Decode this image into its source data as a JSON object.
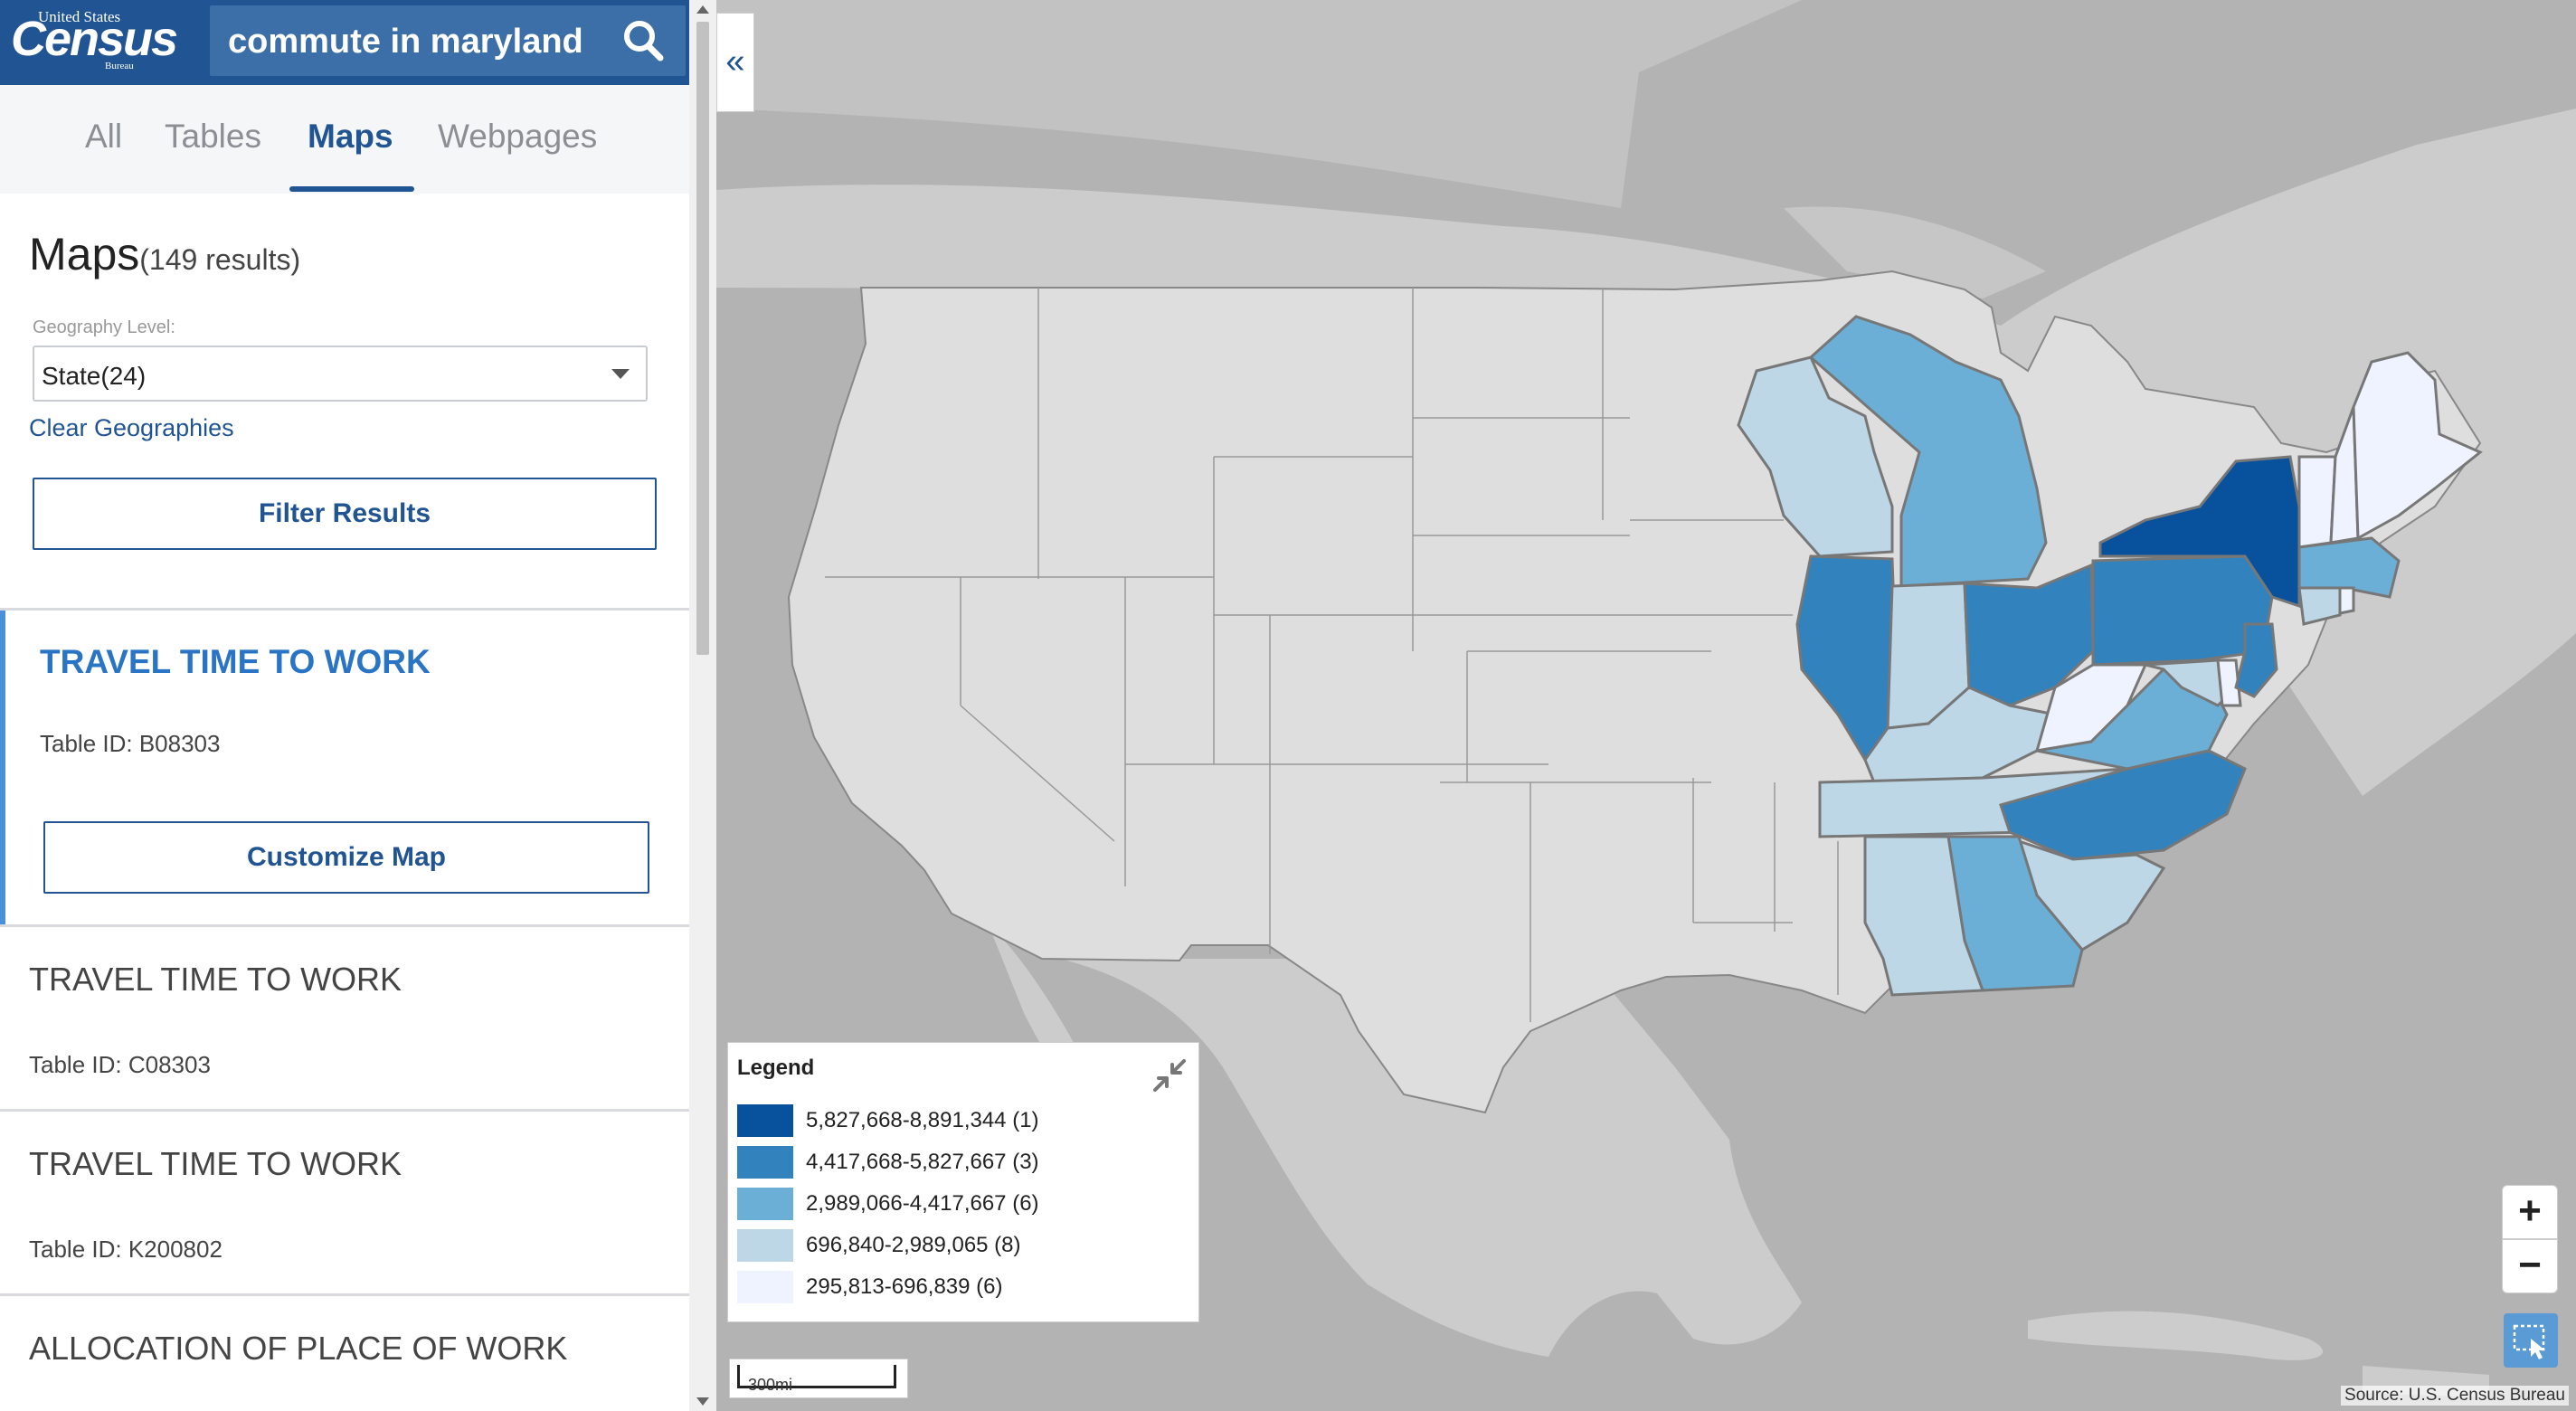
{
  "header": {
    "logo": {
      "line1": "United States",
      "word": "Census",
      "line3": "Bureau"
    },
    "search": {
      "value": "commute in maryland",
      "placeholder": ""
    }
  },
  "tabs": [
    {
      "label": "All",
      "active": false
    },
    {
      "label": "Tables",
      "active": false
    },
    {
      "label": "Maps",
      "active": true
    },
    {
      "label": "Webpages",
      "active": false
    }
  ],
  "results": {
    "heading": "Maps",
    "count": "(149 results)",
    "geography_label": "Geography Level:",
    "geography_value": "State(24)",
    "clear_label": "Clear Geographies",
    "filter_label": "Filter Results"
  },
  "cards": [
    {
      "title": "TRAVEL TIME TO WORK",
      "table_id": "Table ID: B08303",
      "button": "Customize Map",
      "selected": true
    },
    {
      "title": "TRAVEL TIME TO WORK",
      "table_id": "Table ID: C08303"
    },
    {
      "title": "TRAVEL TIME TO WORK",
      "table_id": "Table ID: K200802"
    },
    {
      "title": "ALLOCATION OF PLACE OF WORK"
    }
  ],
  "map": {
    "collapse_icon": "«",
    "legend": {
      "title": "Legend",
      "items": [
        {
          "label": "5,827,668-8,891,344 (1)",
          "color": "#08519c"
        },
        {
          "label": "4,417,668-5,827,667 (3)",
          "color": "#3182bd"
        },
        {
          "label": "2,989,066-4,417,667 (6)",
          "color": "#6baed6"
        },
        {
          "label": "696,840-2,989,065 (8)",
          "color": "#bdd7e7"
        },
        {
          "label": "295,813-696,839 (6)",
          "color": "#eff3ff"
        }
      ]
    },
    "scale": "300mi",
    "zoom_in": "+",
    "zoom_out": "−",
    "source": "Source: U.S. Census Bureau"
  },
  "colors": {
    "header_blue": "#205493",
    "accent_blue": "#2a74c5",
    "map_water": "#b3b3b3",
    "map_land_outside": "#cccccc",
    "map_state_unselected": "#dedede"
  }
}
